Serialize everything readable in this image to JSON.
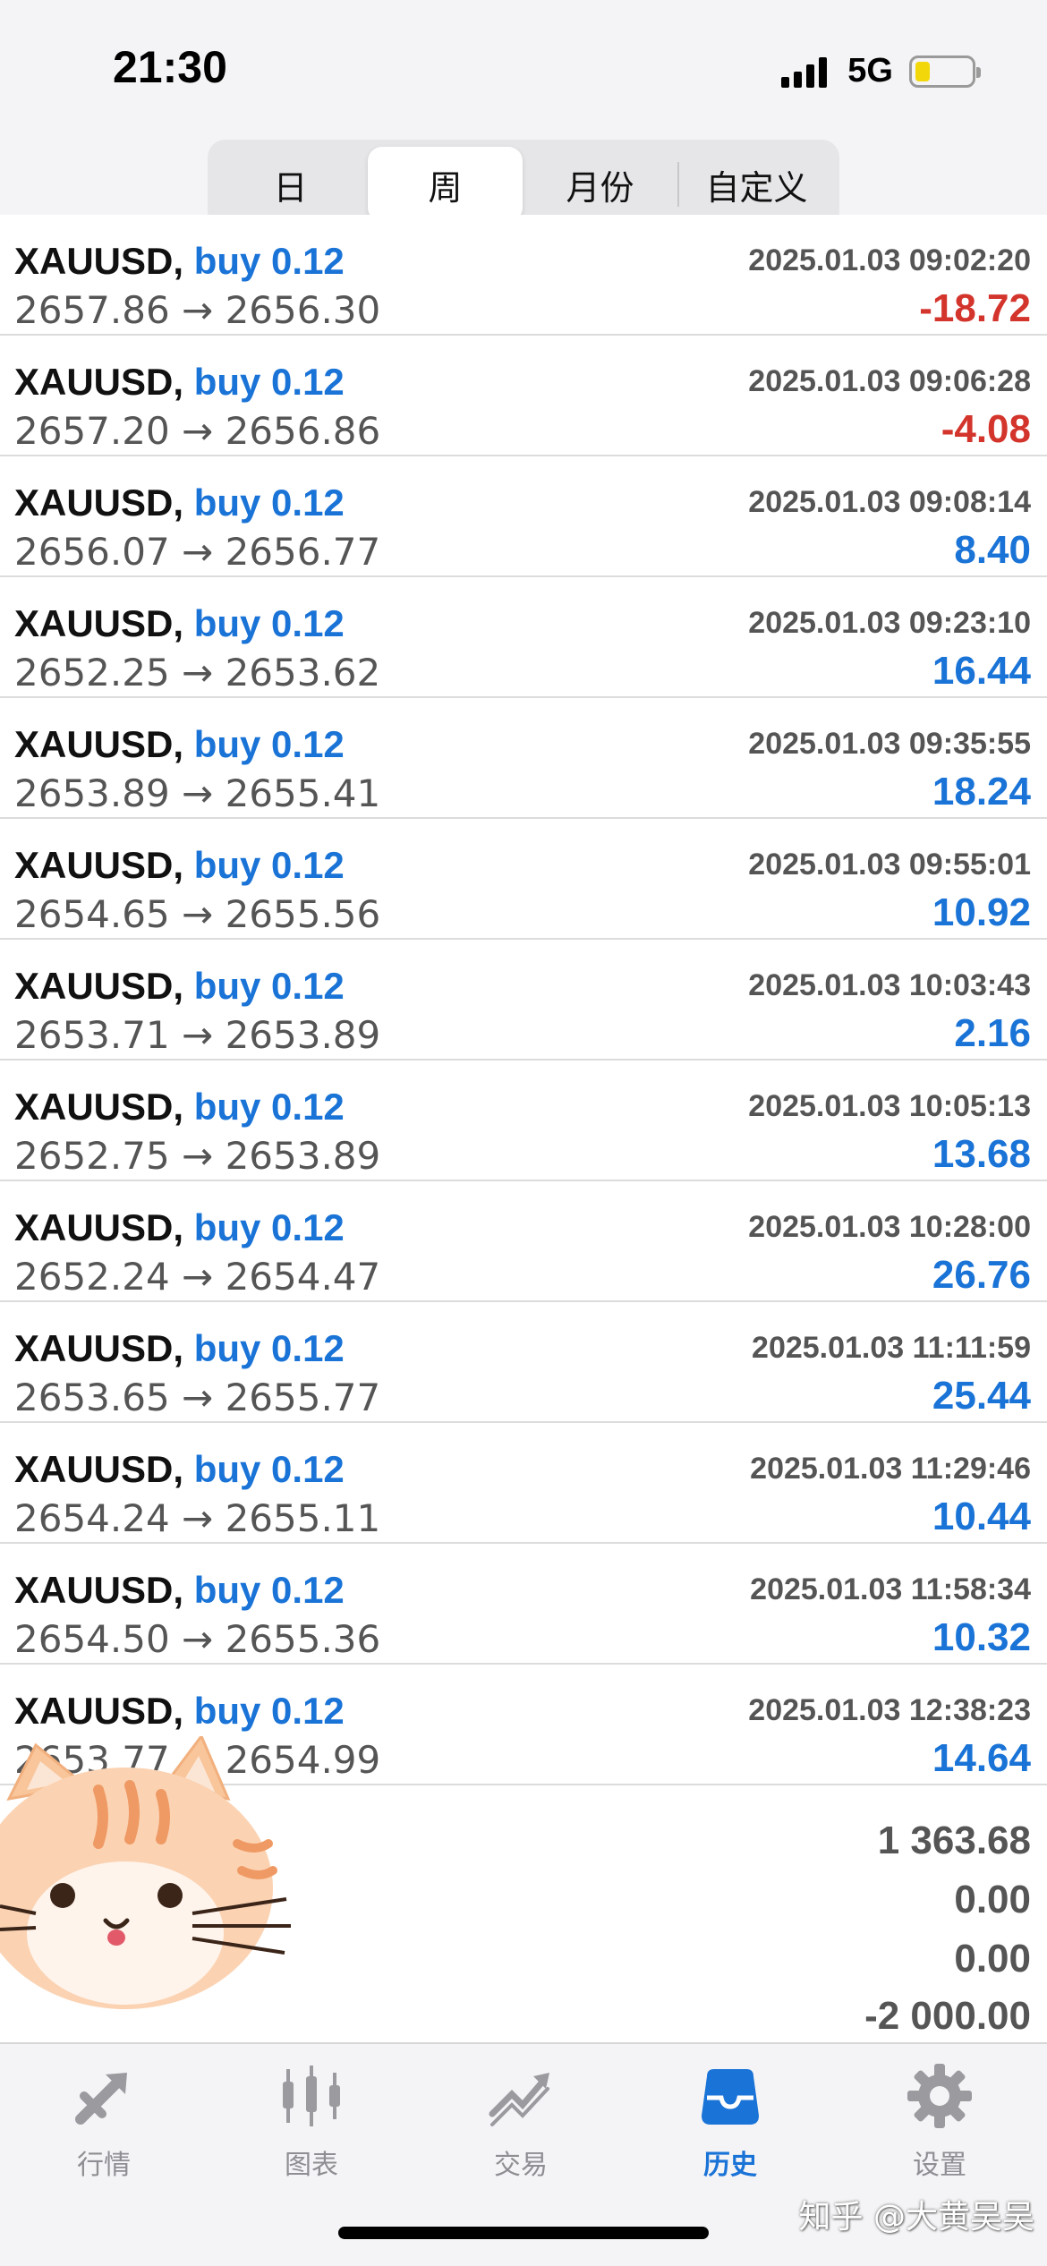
{
  "status_bar": {
    "time": "21:30",
    "network": "5G",
    "battery_color": "#f2d80a"
  },
  "period_tabs": [
    {
      "label": "日",
      "active": false
    },
    {
      "label": "周",
      "active": true
    },
    {
      "label": "月份",
      "active": false
    },
    {
      "label": "自定义",
      "active": false
    }
  ],
  "trades": [
    {
      "symbol": "XAUUSD,",
      "side": "buy 0.12",
      "time": "2025.01.03 09:02:20",
      "prices": "2657.86 → 2656.30",
      "profit": "-18.72",
      "profit_sign": "neg"
    },
    {
      "symbol": "XAUUSD,",
      "side": "buy 0.12",
      "time": "2025.01.03 09:06:28",
      "prices": "2657.20 → 2656.86",
      "profit": "-4.08",
      "profit_sign": "neg"
    },
    {
      "symbol": "XAUUSD,",
      "side": "buy 0.12",
      "time": "2025.01.03 09:08:14",
      "prices": "2656.07 → 2656.77",
      "profit": "8.40",
      "profit_sign": "pos"
    },
    {
      "symbol": "XAUUSD,",
      "side": "buy 0.12",
      "time": "2025.01.03 09:23:10",
      "prices": "2652.25 → 2653.62",
      "profit": "16.44",
      "profit_sign": "pos"
    },
    {
      "symbol": "XAUUSD,",
      "side": "buy 0.12",
      "time": "2025.01.03 09:35:55",
      "prices": "2653.89 → 2655.41",
      "profit": "18.24",
      "profit_sign": "pos"
    },
    {
      "symbol": "XAUUSD,",
      "side": "buy 0.12",
      "time": "2025.01.03 09:55:01",
      "prices": "2654.65 → 2655.56",
      "profit": "10.92",
      "profit_sign": "pos"
    },
    {
      "symbol": "XAUUSD,",
      "side": "buy 0.12",
      "time": "2025.01.03 10:03:43",
      "prices": "2653.71 → 2653.89",
      "profit": "2.16",
      "profit_sign": "pos"
    },
    {
      "symbol": "XAUUSD,",
      "side": "buy 0.12",
      "time": "2025.01.03 10:05:13",
      "prices": "2652.75 → 2653.89",
      "profit": "13.68",
      "profit_sign": "pos"
    },
    {
      "symbol": "XAUUSD,",
      "side": "buy 0.12",
      "time": "2025.01.03 10:28:00",
      "prices": "2652.24 → 2654.47",
      "profit": "26.76",
      "profit_sign": "pos"
    },
    {
      "symbol": "XAUUSD,",
      "side": "buy 0.12",
      "time": "2025.01.03 11:11:59",
      "prices": "2653.65 → 2655.77",
      "profit": "25.44",
      "profit_sign": "pos"
    },
    {
      "symbol": "XAUUSD,",
      "side": "buy 0.12",
      "time": "2025.01.03 11:29:46",
      "prices": "2654.24 → 2655.11",
      "profit": "10.44",
      "profit_sign": "pos"
    },
    {
      "symbol": "XAUUSD,",
      "side": "buy 0.12",
      "time": "2025.01.03 11:58:34",
      "prices": "2654.50 → 2655.36",
      "profit": "10.32",
      "profit_sign": "pos"
    },
    {
      "symbol": "XAUUSD,",
      "side": "buy 0.12",
      "time": "2025.01.03 12:38:23",
      "prices": "2653.77 → 2654.99",
      "profit": "14.64",
      "profit_sign": "pos"
    }
  ],
  "summary": {
    "values": [
      "1 363.68",
      "0.00",
      "0.00",
      "-2 000.00"
    ]
  },
  "tabbar": [
    {
      "label": "行情",
      "icon": "quotes-icon",
      "active": false
    },
    {
      "label": "图表",
      "icon": "chart-icon",
      "active": false
    },
    {
      "label": "交易",
      "icon": "trade-icon",
      "active": false
    },
    {
      "label": "历史",
      "icon": "history-icon",
      "active": true
    },
    {
      "label": "设置",
      "icon": "settings-icon",
      "active": false
    }
  ],
  "watermark": "知乎 @大黄吴吴",
  "colors": {
    "accent": "#1a73d6",
    "loss": "#d3352c",
    "inactive": "#8e8e93"
  }
}
